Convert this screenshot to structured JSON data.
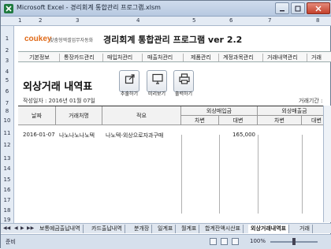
{
  "window": {
    "title": "Microsoft Excel - 경리회계 통합관리 프로그램.xlsm"
  },
  "column_headers": [
    "1",
    "2",
    "3",
    "4",
    "5",
    "6",
    "7",
    "8"
  ],
  "row_headers": [
    "1",
    "2",
    "3",
    "4",
    "5",
    "6",
    "7",
    "8",
    "10",
    "11",
    "12",
    "13",
    "14",
    "15",
    "16",
    "17",
    "18",
    "19"
  ],
  "header": {
    "logo": "coukey",
    "logo_sub": "맞춤형엑셀업무자동화",
    "app_title": "경리회계 통합관리 프로그램 ver 2.2"
  },
  "nav": {
    "items": [
      "기본정보",
      "통장카드관리",
      "매입처관리",
      "매출처관리",
      "제품관리",
      "계정과목관리",
      "거래내역관리",
      "거래"
    ]
  },
  "page": {
    "title": "외상거래 내역표",
    "created_label": "작성일자 : 2016년 01월 07일",
    "right_label": "거래기간 :"
  },
  "toolbar": {
    "extract_label": "추출하기",
    "preview_label": "미리보기",
    "print_label": "출력하기"
  },
  "table": {
    "headers": {
      "date": "날짜",
      "vendor": "거래처명",
      "summary": "적요",
      "receivable_group": "외상매입금",
      "debit": "차변",
      "credit": "대변",
      "payable_group": "외상매출금",
      "debit2": "차변",
      "credit2": "대변"
    },
    "rows": [
      {
        "date": "2016-01-07",
        "vendor": "나노나노나노텍",
        "summary": "나노텍-외상으로자과구매",
        "debit": "",
        "credit": "165,000",
        "debit2": "",
        "credit2": ""
      }
    ]
  },
  "sheet_tabs": [
    "보통예금출납내역",
    "카드출납내역",
    "분개장",
    "일계표",
    "월계표",
    "합계잔액시산표",
    "외상거래내역표",
    "거래"
  ],
  "active_tab": "외상거래내역표",
  "status": {
    "ready": "준비",
    "zoom": "100%"
  },
  "colors": {
    "logo": "#e06a18",
    "excel_green": "#1f7a3f"
  }
}
